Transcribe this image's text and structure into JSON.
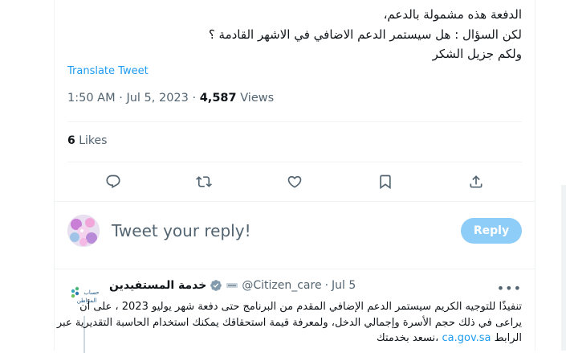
{
  "tweet": {
    "lines": [
      "الدفعة هذه مشمولة بالدعم،",
      "لكن السؤال : هل سيستمر الدعم الاضافي في الاشهر القادمة ؟",
      "ولكم جزيل الشكر"
    ],
    "translate_label": "Translate Tweet",
    "time": "1:50 AM",
    "date": "Jul 5, 2023",
    "views_count": "4,587",
    "views_label": "Views",
    "likes_count": "6",
    "likes_label": "Likes"
  },
  "actions": [
    {
      "name": "reply",
      "icon": "comment-icon"
    },
    {
      "name": "retweet",
      "icon": "retweet-icon"
    },
    {
      "name": "like",
      "icon": "heart-icon"
    },
    {
      "name": "bookmark",
      "icon": "bookmark-icon"
    },
    {
      "name": "share",
      "icon": "share-icon"
    }
  ],
  "composer": {
    "placeholder": "Tweet your reply!",
    "button_label": "Reply"
  },
  "reply_tweet": {
    "display_name": "خدمة المستفيدين",
    "handle": "@Citizen_care",
    "date": "Jul 5",
    "text_lines": [
      "تنفيذًا للتوجيه الكريم سيستمر الدعم الإضافي المقدم من البرنامج حتى دفعة شهر يوليو 2023 ، على أن",
      "يراعى في ذلك حجم الأسرة وإجمالي الدخل، ولمعرفة قيمة استحقاقك يمكنك استخدام الحاسبة التقديرية عبر",
      "الرابط"
    ],
    "link_text": "ca.gov.sa",
    "tail_text": "،نسعد بخدمتك",
    "logo_text": "حساب المواطن"
  },
  "colors": {
    "accent": "#1d9bf0",
    "reply_button_disabled": "#8ecdf8",
    "secondary_text": "#536471",
    "primary_text": "#0f1419",
    "border": "#eff3f4"
  }
}
